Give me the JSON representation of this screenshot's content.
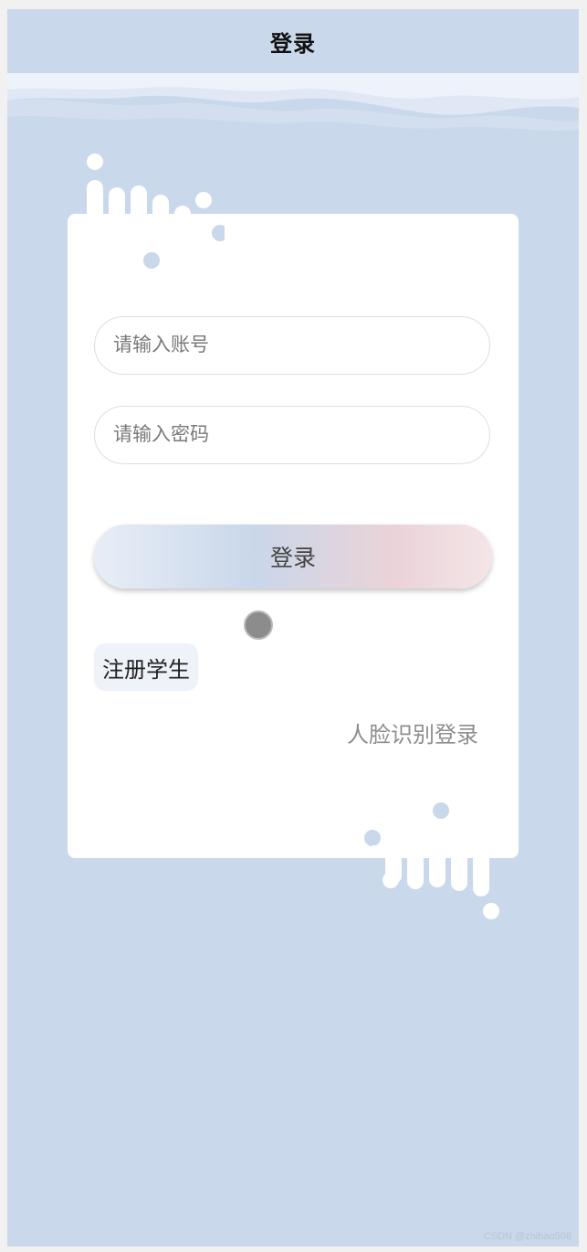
{
  "navbar": {
    "title": "登录"
  },
  "form": {
    "account_placeholder": "请输入账号",
    "password_placeholder": "请输入密码",
    "login_label": "登录",
    "register_label": "注册学生",
    "face_login_label": "人脸识别登录"
  },
  "watermark": "CSDN @zhihao508",
  "colors": {
    "background": "#c9d8ea",
    "card": "#ffffff",
    "deco": "#ffffff",
    "deco_accent": "#c9d8ea"
  }
}
